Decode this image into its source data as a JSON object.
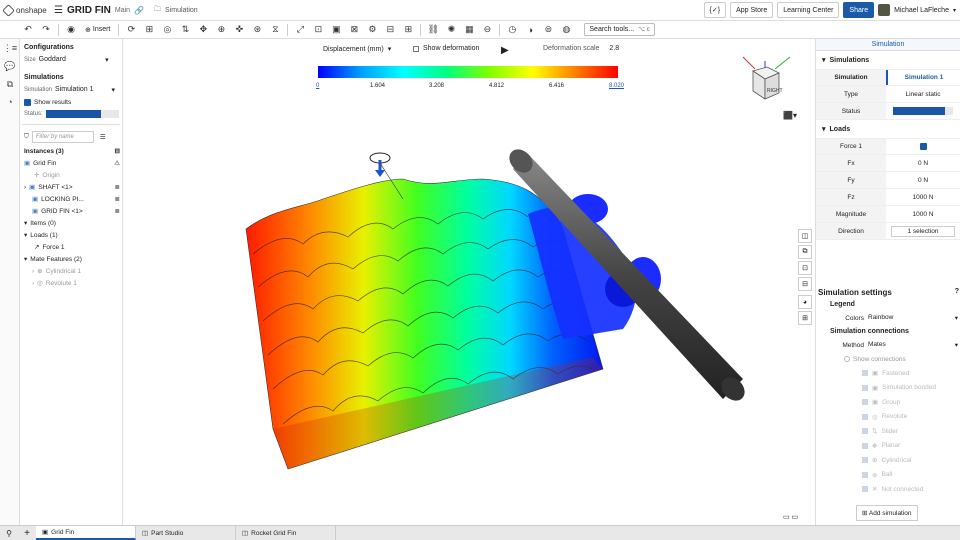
{
  "app": {
    "logo": "onshape",
    "doc_title": "GRID FIN",
    "branch": "Main",
    "crumb": "Simulation"
  },
  "top_right": {
    "app_store": "App Store",
    "learning_center": "Learning Center",
    "share": "Share",
    "user": "Michael LaFleche"
  },
  "toolbar": {
    "insert": "Insert",
    "search_tools": "Search tools...",
    "search_shortcut": "⌥ c"
  },
  "features": {
    "configurations": "Configurations",
    "size_label": "Size",
    "size_value": "Goddard",
    "simulations": "Simulations",
    "simulation_label": "Simulation",
    "simulation_value": "Simulation 1",
    "show_results": "Show results",
    "status_label": "Status:",
    "filter_placeholder": "Filter by name",
    "instances": "Instances (3)",
    "grid_fin": "Grid Fin",
    "origin": "Origin",
    "shaft": "SHAFT <1>",
    "locking": "LOCKING PI...",
    "grid_fin_1": "GRID FIN <1>",
    "items": "Items (0)",
    "loads": "Loads (1)",
    "force1": "Force 1",
    "mate_features": "Mate Features (2)",
    "cylindrical": "Cylindrical 1",
    "revolute": "Revolute 1"
  },
  "viewport": {
    "result_type": "Displacement (mm)",
    "show_deformation": "Show deformation",
    "deformation_scale_label": "Deformation scale",
    "deformation_scale_value": "2.8",
    "legend_ticks": [
      "0",
      "1.604",
      "3.208",
      "4.812",
      "6.416",
      "8.020"
    ],
    "view_cube_label": "RIGHT"
  },
  "right_panel": {
    "tab": "Simulation",
    "simulations_header": "Simulations",
    "sim_col_label": "Simulation",
    "sim_col_value": "Simulation 1",
    "type_label": "Type",
    "type_value": "Linear static",
    "status_label": "Status",
    "loads_header": "Loads",
    "force_label": "Force 1",
    "fx_label": "Fx",
    "fx_value": "0 N",
    "fy_label": "Fy",
    "fy_value": "0 N",
    "fz_label": "Fz",
    "fz_value": "1000 N",
    "magnitude_label": "Magnitude",
    "magnitude_value": "1000 N",
    "direction_label": "Direction",
    "direction_value": "1 selection",
    "settings_header": "Simulation settings",
    "legend_header": "Legend",
    "colors_label": "Colors",
    "colors_value": "Rainbow",
    "connections_header": "Simulation connections",
    "method_label": "Method",
    "method_value": "Mates",
    "show_connections": "Show connections",
    "connection_types": [
      "Fastened",
      "Simulation bonded",
      "Group",
      "Revolute",
      "Slider",
      "Planar",
      "Cylindrical",
      "Ball",
      "Not connected"
    ],
    "add_simulation": "Add simulation"
  },
  "bottom_tabs": [
    "Grid Fin",
    "Part Studio",
    "Rocket Grid Fin"
  ],
  "colors": {
    "accent": "#1b5aa6",
    "status_fill": "#1b55a8"
  }
}
